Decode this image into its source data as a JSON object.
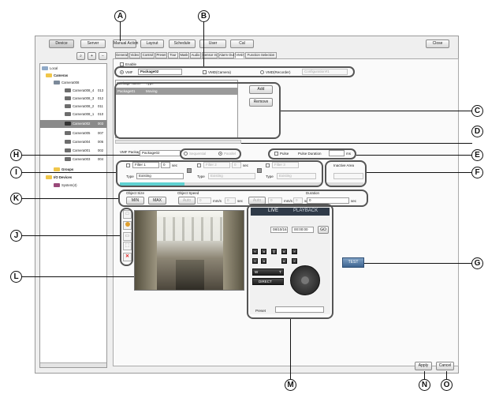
{
  "toolbar": {
    "device": "Device",
    "server": "Server"
  },
  "main_tabs": [
    "Manual Action",
    "Layout",
    "Schedule",
    "User",
    "Cal"
  ],
  "close_label": "Close",
  "sub_tabs": [
    "General",
    "Video",
    "Control",
    "Preset",
    "Tour",
    "Mask",
    "Audio",
    "Sensor In",
    "Alarm Out",
    "VMD",
    "Function Selection"
  ],
  "tree": {
    "root": "Local",
    "cameras_group": "Cameras",
    "items": [
      {
        "name": "Camera008",
        "num": ""
      },
      {
        "name": "Camera008_4",
        "num": "013"
      },
      {
        "name": "Camera008_3",
        "num": "012"
      },
      {
        "name": "Camera008_2",
        "num": "011"
      },
      {
        "name": "Camera008_1",
        "num": "010"
      },
      {
        "name": "Camera002",
        "num": "003"
      },
      {
        "name": "Camera005",
        "num": "007"
      },
      {
        "name": "Camera004",
        "num": "006"
      },
      {
        "name": "Camera001",
        "num": "002"
      },
      {
        "name": "Camera003",
        "num": "004"
      }
    ],
    "groups": "Groups",
    "io_devices": "I/O Devices",
    "system": "System(4)"
  },
  "vmd": {
    "enable_label": "Enable",
    "vmf_label": "VMF",
    "package_value": "Package02",
    "camera_option": "VMD(Camera)",
    "recorder_option": "VMD(Recorder)",
    "configuration_value": "Configuration#1",
    "table_headers": [
      "Package Name",
      "Type"
    ],
    "table_rows": [
      {
        "name": "Package01",
        "type": "Moving"
      }
    ],
    "add_label": "Add",
    "remove_label": "Remove",
    "vmf_package_label": "VMF Package",
    "vmf_package_value": "Package02",
    "sequential": "Sequential",
    "parallel": "Parallel",
    "pulse_label": "Pulse",
    "pulse_duration_label": "Pulse Duration",
    "ms_label": "ms",
    "filter1": "Filter 1",
    "filter2": "Filter 2",
    "filter3": "Filter 3",
    "sec": "sec",
    "type_label": "Type",
    "type_value": "Existing",
    "inactive_area": "Inactive Area",
    "object_size": "Object Size",
    "object_speed": "Object Speed",
    "duration": "Duration",
    "min": "MIN",
    "max": "MAX",
    "auto": "Auto",
    "mm_s": "mm/s",
    "zero": "0"
  },
  "viewer": {
    "live": "LIVE",
    "playback": "PLAYBACK",
    "date": "08/10/16",
    "time": "00:00:00",
    "go": "GO",
    "w": "W",
    "t": "T",
    "direct": "DIRECT",
    "preset": "Preset",
    "test": "TEST"
  },
  "apply_label": "Apply",
  "cancel_label": "Cancel",
  "callouts": [
    "A",
    "B",
    "C",
    "D",
    "E",
    "F",
    "G",
    "H",
    "I",
    "J",
    "K",
    "L",
    "M",
    "N",
    "O"
  ]
}
